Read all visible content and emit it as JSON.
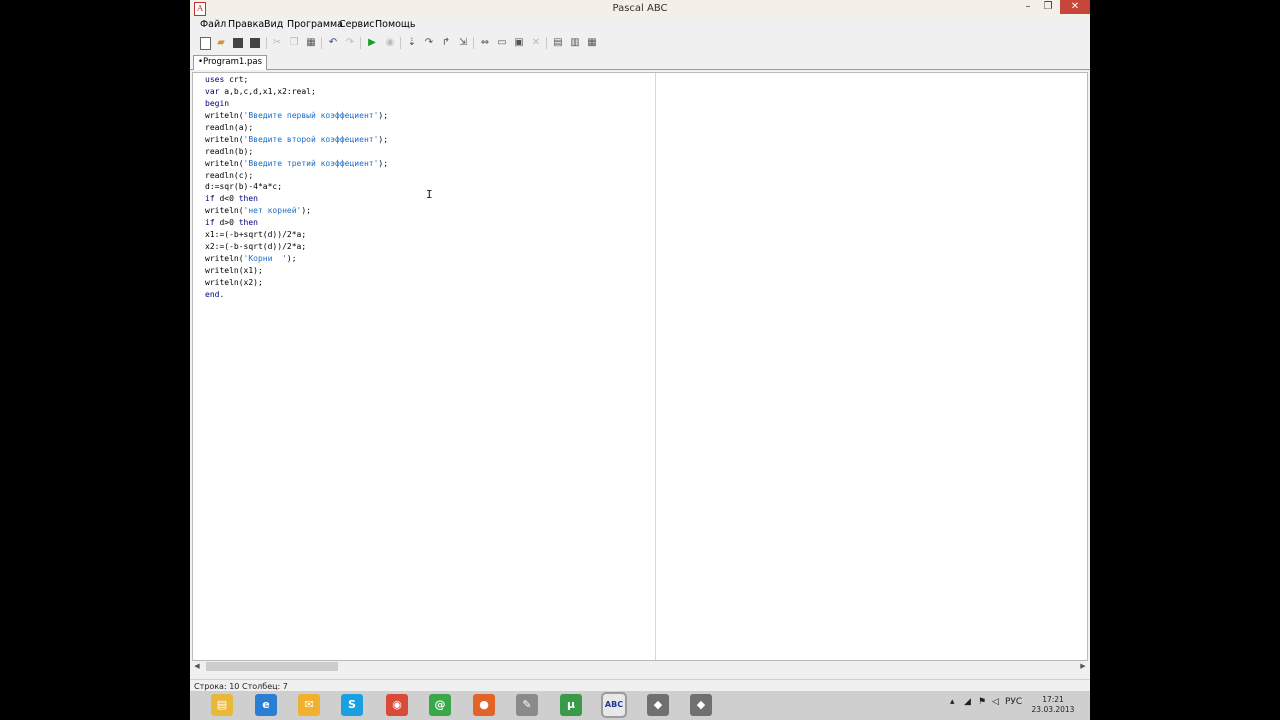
{
  "window": {
    "title": "Pascal ABC",
    "app_icon": "ABC-icon"
  },
  "window_controls": {
    "minimize": "–",
    "maximize": "❐",
    "close": "✕"
  },
  "menu": [
    "Файл",
    "Правка",
    "Вид",
    "Программа",
    "Сервис",
    "Помощь"
  ],
  "toolbar_icons": [
    "new-file-icon",
    "open-icon",
    "save-icon",
    "save-all-icon",
    "cut-icon",
    "copy-icon",
    "paste-icon",
    "undo-icon",
    "redo-icon",
    "run-icon",
    "stop-icon",
    "step-into-icon",
    "step-over-icon",
    "step-out-icon",
    "run-to-cursor-icon",
    "watch-icon",
    "window-icon",
    "locals-icon",
    "close-debug-icon",
    "format-icon",
    "compile-icon",
    "options-icon"
  ],
  "tab": {
    "label": "•Program1.pas"
  },
  "code_lines": [
    [
      {
        "t": "uses",
        "k": "kw"
      },
      {
        "t": " crt;",
        "k": ""
      }
    ],
    [
      {
        "t": "var",
        "k": "kw"
      },
      {
        "t": " a,b,c,d,x1,x2:real;",
        "k": ""
      }
    ],
    [
      {
        "t": "begin",
        "k": "kw"
      }
    ],
    [
      {
        "t": "writeln(",
        "k": ""
      },
      {
        "t": "'Введите первый коэффециент'",
        "k": "str"
      },
      {
        "t": ");",
        "k": ""
      }
    ],
    [
      {
        "t": "readln(a);",
        "k": ""
      }
    ],
    [
      {
        "t": "writeln(",
        "k": ""
      },
      {
        "t": "'Введите второй коэффециент'",
        "k": "str"
      },
      {
        "t": ");",
        "k": ""
      }
    ],
    [
      {
        "t": "readln(b);",
        "k": ""
      }
    ],
    [
      {
        "t": "writeln(",
        "k": ""
      },
      {
        "t": "'Введите третий коэффециент'",
        "k": "str"
      },
      {
        "t": ");",
        "k": ""
      }
    ],
    [
      {
        "t": "readln(c);",
        "k": ""
      }
    ],
    [
      {
        "t": "d:=sqr(b)-4*a*c;",
        "k": ""
      }
    ],
    [
      {
        "t": "if",
        "k": "kw"
      },
      {
        "t": " d<0 ",
        "k": ""
      },
      {
        "t": "then",
        "k": "kw"
      }
    ],
    [
      {
        "t": "writeln(",
        "k": ""
      },
      {
        "t": "'нет корней'",
        "k": "str"
      },
      {
        "t": ");",
        "k": ""
      }
    ],
    [
      {
        "t": "if",
        "k": "kw"
      },
      {
        "t": " d>0 ",
        "k": ""
      },
      {
        "t": "then",
        "k": "kw"
      }
    ],
    [
      {
        "t": "x1:=(-b+sqrt(d))/2*a;",
        "k": ""
      }
    ],
    [
      {
        "t": "x2:=(-b-sqrt(d))/2*a;",
        "k": ""
      }
    ],
    [
      {
        "t": "writeln(",
        "k": ""
      },
      {
        "t": "'Корни  '",
        "k": "str"
      },
      {
        "t": ");",
        "k": ""
      }
    ],
    [
      {
        "t": "writeln(x1);",
        "k": ""
      }
    ],
    [
      {
        "t": "writeln(x2);",
        "k": ""
      }
    ],
    [
      {
        "t": "end.",
        "k": "kw"
      }
    ]
  ],
  "scrollbar": {
    "left_arrow": "◀",
    "right_arrow": "▶"
  },
  "status": {
    "row": "Строка: 10",
    "col": "Столбец: 7"
  },
  "taskbar": {
    "apps": [
      {
        "name": "file-explorer-icon",
        "glyph": "▤",
        "color": "#e8b83a"
      },
      {
        "name": "internet-explorer-icon",
        "glyph": "e",
        "color": "#2a7fd4"
      },
      {
        "name": "mail-icon",
        "glyph": "✉",
        "color": "#f0b030"
      },
      {
        "name": "skype-icon",
        "glyph": "S",
        "color": "#1aa0e0"
      },
      {
        "name": "chrome-icon",
        "glyph": "◉",
        "color": "#d94a38"
      },
      {
        "name": "mail-agent-icon",
        "glyph": "@",
        "color": "#3aa84a"
      },
      {
        "name": "orange-app-icon",
        "glyph": "●",
        "color": "#e0642a"
      },
      {
        "name": "tools-icon",
        "glyph": "✎",
        "color": "#8a8a8a"
      },
      {
        "name": "utorrent-icon",
        "glyph": "µ",
        "color": "#3a9a4a"
      },
      {
        "name": "pascal-abc-taskbar-icon",
        "glyph": "ABC",
        "color": "#e8e8e8"
      },
      {
        "name": "app-icon-a",
        "glyph": "◆",
        "color": "#707070"
      },
      {
        "name": "app-icon-b",
        "glyph": "◆",
        "color": "#707070"
      }
    ],
    "tray": {
      "lang": "РУС",
      "time": "17:21",
      "date": "23.03.2013"
    }
  }
}
